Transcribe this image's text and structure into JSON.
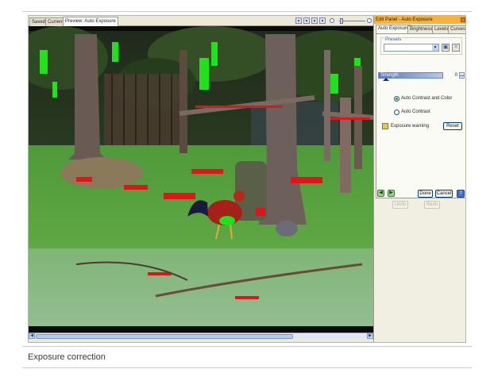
{
  "tabs": [
    {
      "label": "Saved"
    },
    {
      "label": "Current"
    },
    {
      "label": "Preview: Auto Exposure"
    }
  ],
  "toolbar": {
    "icons": [
      "view-single-icon",
      "view-split-icon",
      "view-compare-icon",
      "view-fit-icon",
      "zoom-out-icon",
      "zoom-slider",
      "zoom-in-icon"
    ]
  },
  "panel": {
    "title": "Edit Panel - Auto Exposure",
    "tabs": [
      {
        "label": "Auto Exposure"
      },
      {
        "label": "Brightness"
      },
      {
        "label": "Levels"
      },
      {
        "label": "Curves"
      }
    ],
    "presets_label": "Presets",
    "presets_value": "",
    "strength_label": "Strength",
    "strength_value": "0",
    "radio_options": [
      {
        "label": "Auto Contrast and Color",
        "selected": true
      },
      {
        "label": "Auto Contrast",
        "selected": false
      }
    ],
    "exposure_warning_label": "Exposure warning",
    "reset_label": "Reset",
    "done_label": "Done",
    "cancel_label": "Cancel",
    "undo_label": "Undo",
    "redo_label": "Redo",
    "help_label": "?"
  },
  "caption": "Exposure correction",
  "colors": {
    "title_bar": "#f6b23c",
    "warning_overexposed": "#e0141c",
    "warning_underexposed": "#22e01c"
  }
}
